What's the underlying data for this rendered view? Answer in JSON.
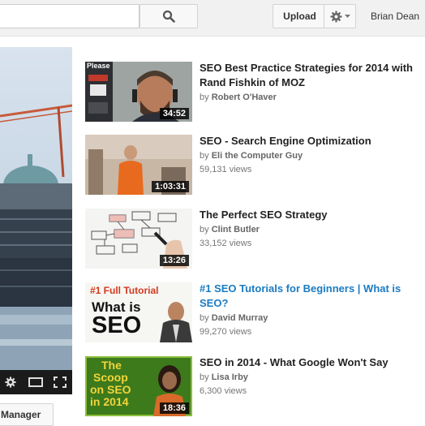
{
  "header": {
    "upload_label": "Upload",
    "user_name": "Brian Dean"
  },
  "player": {
    "manager_label": "Manager"
  },
  "related": [
    {
      "title": "SEO Best Practice Strategies for 2014 with Rand Fishkin of MOZ",
      "by": "by",
      "author": "Robert O'Haver",
      "views": "",
      "duration": "34:52",
      "thumb_text": "Please"
    },
    {
      "title": "SEO - Search Engine Optimization",
      "by": "by",
      "author": "Eli the Computer Guy",
      "views": "59,131 views",
      "duration": "1:03:31"
    },
    {
      "title": "The Perfect SEO Strategy",
      "by": "by",
      "author": "Clint Butler",
      "views": "33,152 views",
      "duration": "13:26"
    },
    {
      "title": "#1 SEO Tutorials for Beginners | What is SEO?",
      "by": "by",
      "author": "David Murray",
      "views": "99,270 views",
      "duration": "",
      "thumb_line1": "#1 Full Tutorial",
      "thumb_line2": "What is",
      "thumb_line3": "SEO"
    },
    {
      "title": "SEO in 2014 - What Google Won't Say",
      "by": "by",
      "author": "Lisa Irby",
      "views": "6,300 views",
      "duration": "18:36",
      "thumb_line1": "The",
      "thumb_line2": "Scoop",
      "thumb_line3": "on SEO",
      "thumb_line4": "in 2014"
    }
  ],
  "colors": {
    "link_blue": "#1b7bc2",
    "meta_gray": "#767676",
    "controls_bg": "#1b1b1b"
  }
}
